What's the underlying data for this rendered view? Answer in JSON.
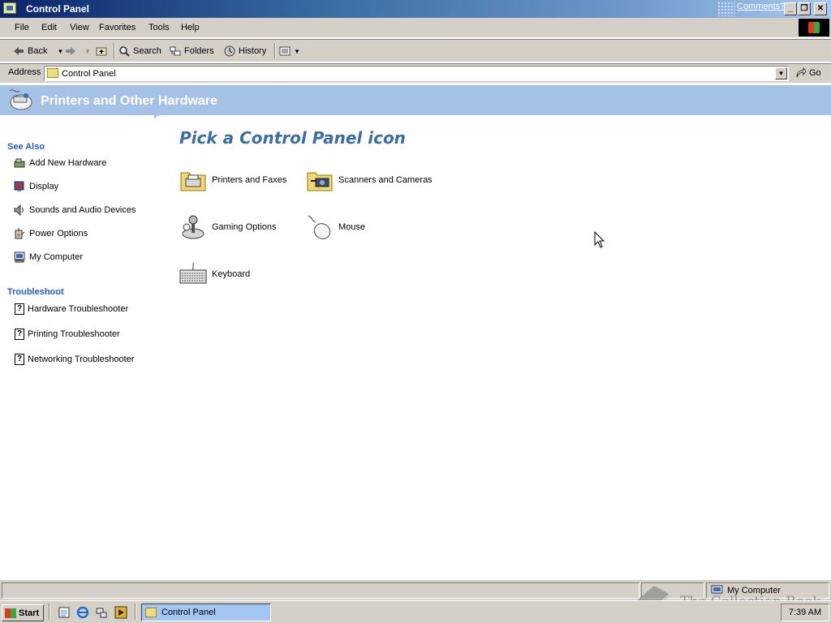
{
  "window": {
    "title": "Control Panel",
    "comments_link": "Comments?",
    "controls": {
      "minimize": "_",
      "restore": "❐",
      "close": "✕"
    }
  },
  "menu": [
    "File",
    "Edit",
    "View",
    "Favorites",
    "Tools",
    "Help"
  ],
  "toolbar": {
    "back": "Back",
    "search": "Search",
    "folders": "Folders",
    "history": "History"
  },
  "address": {
    "label": "Address",
    "value": "Control Panel",
    "go": "Go"
  },
  "banner": {
    "title": "Printers and Other Hardware",
    "color": "#a5c2e6"
  },
  "sidebar": {
    "see_also": {
      "heading": "See Also",
      "items": [
        {
          "label": "Add New Hardware",
          "icon": "hardware-icon"
        },
        {
          "label": "Display",
          "icon": "display-icon"
        },
        {
          "label": "Sounds and Audio Devices",
          "icon": "speaker-icon"
        },
        {
          "label": "Power Options",
          "icon": "power-icon"
        },
        {
          "label": "My Computer",
          "icon": "computer-icon"
        }
      ]
    },
    "troubleshoot": {
      "heading": "Troubleshoot",
      "items": [
        {
          "label": "Hardware Troubleshooter",
          "icon": "help-icon"
        },
        {
          "label": "Printing Troubleshooter",
          "icon": "help-icon"
        },
        {
          "label": "Networking Troubleshooter",
          "icon": "help-icon"
        }
      ]
    }
  },
  "main": {
    "heading": "Pick a Control Panel icon",
    "items": [
      {
        "label": "Printers and Faxes",
        "icon": "printer-folder-icon"
      },
      {
        "label": "Scanners and Cameras",
        "icon": "camera-folder-icon"
      },
      {
        "label": "Gaming Options",
        "icon": "joystick-icon"
      },
      {
        "label": "Mouse",
        "icon": "mouse-icon"
      },
      {
        "label": "Keyboard",
        "icon": "keyboard-icon"
      }
    ]
  },
  "statusbar": {
    "location": "My Computer"
  },
  "taskbar": {
    "start": "Start",
    "task": "Control Panel",
    "clock": "7:39 AM"
  },
  "watermark": {
    "text": "The Collection Book"
  },
  "colors": {
    "link_heading": "#215dc6",
    "main_heading": "#3a6ea5",
    "chrome": "#d4d0c8"
  }
}
